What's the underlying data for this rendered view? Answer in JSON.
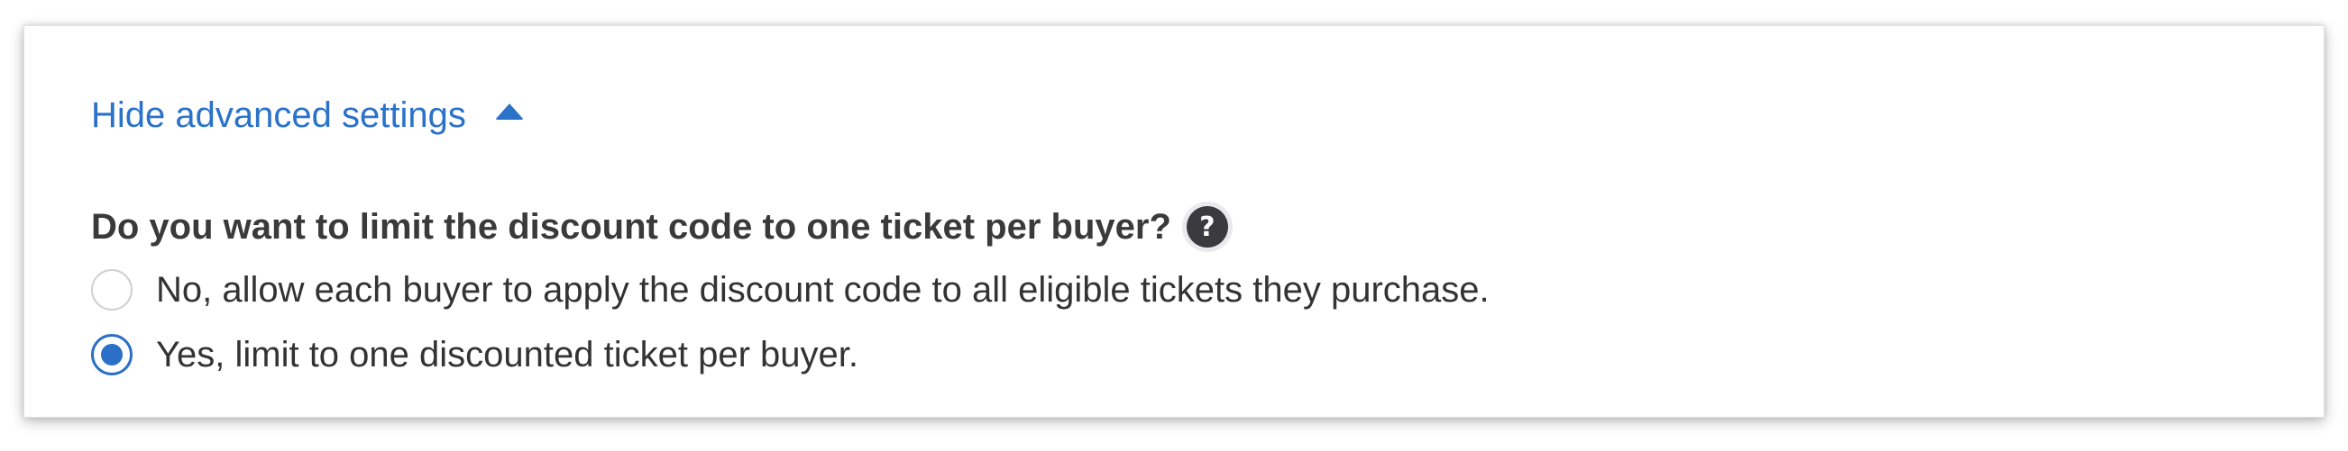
{
  "advanced_toggle": {
    "label": "Hide advanced settings",
    "icon": "caret-up-icon"
  },
  "question": {
    "text": "Do you want to limit the discount code to one ticket per buyer?",
    "help_symbol": "?"
  },
  "options": [
    {
      "label": "No, allow each buyer to apply the discount code to all eligible tickets they purchase.",
      "selected": false
    },
    {
      "label": "Yes, limit to one discounted ticket per buyer.",
      "selected": true
    }
  ],
  "colors": {
    "link": "#2b72c9",
    "radio_checked": "#2b6fc7",
    "help_icon_bg": "#3b3b3f"
  }
}
